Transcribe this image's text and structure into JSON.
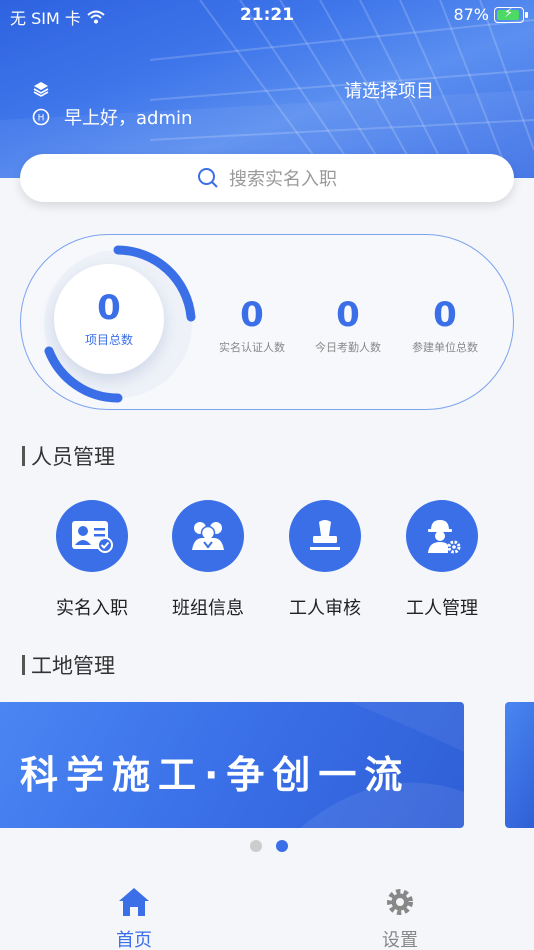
{
  "status_bar": {
    "carrier": "无 SIM 卡",
    "time": "21:21",
    "battery": "87%"
  },
  "header": {
    "greeting": "早上好，admin",
    "select_project": "请选择项目"
  },
  "search": {
    "placeholder": "搜索实名入职"
  },
  "stats": {
    "project_total": {
      "value": "0",
      "label": "项目总数"
    },
    "items": [
      {
        "value": "0",
        "label": "实名认证人数"
      },
      {
        "value": "0",
        "label": "今日考勤人数"
      },
      {
        "value": "0",
        "label": "参建单位总数"
      }
    ]
  },
  "sections": {
    "personnel": "人员管理",
    "site": "工地管理"
  },
  "personnel_menu": [
    {
      "label": "实名入职",
      "icon": "id-card-icon"
    },
    {
      "label": "班组信息",
      "icon": "team-icon"
    },
    {
      "label": "工人审核",
      "icon": "stamp-icon"
    },
    {
      "label": "工人管理",
      "icon": "worker-gear-icon"
    }
  ],
  "banner": {
    "text": "科学施工·争创一流"
  },
  "tabbar": {
    "home": "首页",
    "settings": "设置"
  },
  "colors": {
    "accent": "#3a6fe8",
    "background": "#f4f6fa"
  }
}
